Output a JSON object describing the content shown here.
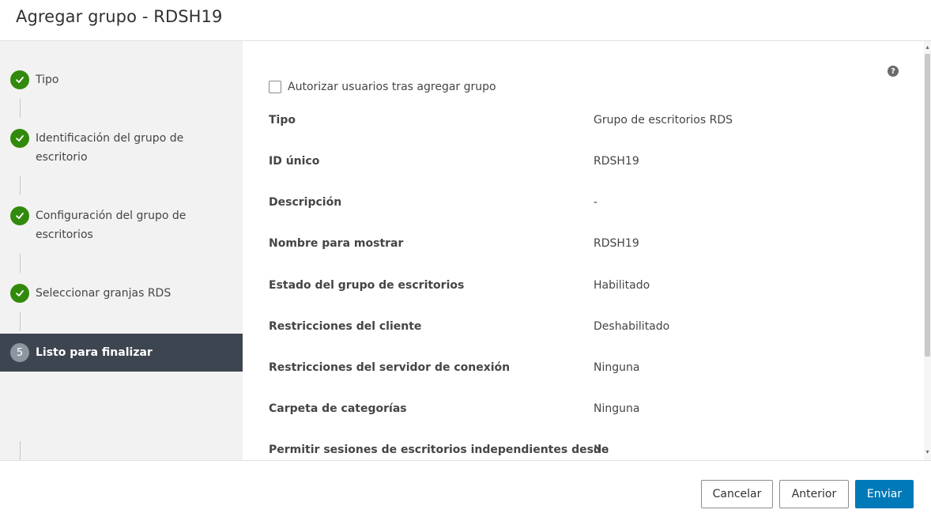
{
  "dialog": {
    "title": "Agregar grupo - RDSH19"
  },
  "steps": [
    {
      "label": "Tipo",
      "status": "complete"
    },
    {
      "label": "Identificación del grupo de escritorio",
      "status": "complete"
    },
    {
      "label": "Configuración del grupo de escritorios",
      "status": "complete"
    },
    {
      "label": "Seleccionar granjas RDS",
      "status": "complete"
    },
    {
      "number": "5",
      "label": "Listo para finalizar",
      "status": "active"
    }
  ],
  "content": {
    "checkbox_label": "Autorizar usuarios tras agregar grupo",
    "checkbox_checked": false,
    "help_icon": "question-circle-icon",
    "summary": [
      {
        "key": "Tipo",
        "value": "Grupo de escritorios RDS"
      },
      {
        "key": "ID único",
        "value": "RDSH19"
      },
      {
        "key": "Descripción",
        "value": "-"
      },
      {
        "key": "Nombre para mostrar",
        "value": "RDSH19"
      },
      {
        "key": "Estado del grupo de escritorios",
        "value": "Habilitado"
      },
      {
        "key": "Restricciones del cliente",
        "value": "Deshabilitado"
      },
      {
        "key": "Restricciones del servidor de conexión",
        "value": "Ninguna"
      },
      {
        "key": "Carpeta de categorías",
        "value": "Ninguna"
      },
      {
        "key": "Permitir sesiones de escritorios independientes desde",
        "value": "No"
      }
    ]
  },
  "footer": {
    "cancel_label": "Cancelar",
    "back_label": "Anterior",
    "submit_label": "Enviar"
  },
  "colors": {
    "step_complete": "#328a0c",
    "step_active_bg": "#3d4550",
    "primary_button": "#0079b8"
  }
}
